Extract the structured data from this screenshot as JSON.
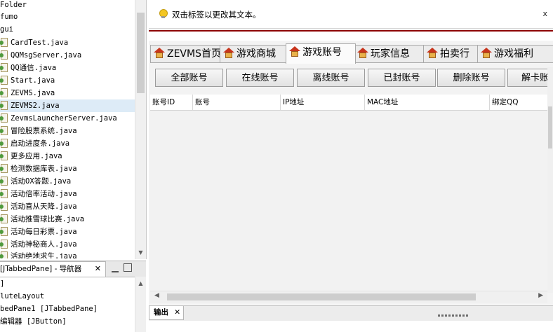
{
  "project_tree": {
    "items": [
      {
        "label": "Folder",
        "icon": "folder-icon"
      },
      {
        "label": "fumo",
        "icon": "folder-icon"
      },
      {
        "label": "gui",
        "icon": "folder-icon"
      },
      {
        "label": "CardTest.java",
        "icon": "java-file-icon"
      },
      {
        "label": "QQMsgServer.java",
        "icon": "java-file-icon"
      },
      {
        "label": "QQ通信.java",
        "icon": "java-file-icon"
      },
      {
        "label": "Start.java",
        "icon": "java-file-icon"
      },
      {
        "label": "ZEVMS.java",
        "icon": "java-file-icon"
      },
      {
        "label": "ZEVMS2.java",
        "icon": "java-file-icon"
      },
      {
        "label": "ZevmsLauncherServer.java",
        "icon": "java-file-icon"
      },
      {
        "label": "冒险股票系统.java",
        "icon": "java-file-icon"
      },
      {
        "label": "启动进度条.java",
        "icon": "java-file-icon"
      },
      {
        "label": "更多应用.java",
        "icon": "java-file-icon"
      },
      {
        "label": "检测数据库表.java",
        "icon": "java-file-icon"
      },
      {
        "label": "活动OX答题.java",
        "icon": "java-file-icon"
      },
      {
        "label": "活动倍率活动.java",
        "icon": "java-file-icon"
      },
      {
        "label": "活动喜从天降.java",
        "icon": "java-file-icon"
      },
      {
        "label": "活动推雪球比赛.java",
        "icon": "java-file-icon"
      },
      {
        "label": "活动每日彩票.java",
        "icon": "java-file-icon"
      },
      {
        "label": "活动神秘商人.java",
        "icon": "java-file-icon"
      },
      {
        "label": "活动绝地求生.java",
        "icon": "java-file-icon"
      }
    ],
    "selected_index": 8
  },
  "navigator": {
    "tab_label": "[JTabbedPane] - 导航器",
    "tab_close": "✕",
    "items": [
      {
        "label": "]"
      },
      {
        "label": "luteLayout"
      },
      {
        "label": "bedPane1 [JTabbedPane]"
      },
      {
        "label": "编辑器 [JButton]"
      }
    ]
  },
  "message_bar": {
    "text": "双击标签以更改其文本。",
    "close": "x",
    "icon": "lightbulb-icon"
  },
  "tabs": [
    {
      "label": "ZEVMS首页",
      "icon": "house-icon"
    },
    {
      "label": "游戏商城",
      "icon": "house-icon"
    },
    {
      "label": "游戏账号",
      "icon": "house-icon",
      "active": true
    },
    {
      "label": "玩家信息",
      "icon": "house-icon"
    },
    {
      "label": "拍卖行",
      "icon": "house-icon"
    },
    {
      "label": "游戏福利",
      "icon": "house-icon"
    }
  ],
  "buttons": [
    "全部账号",
    "在线账号",
    "离线账号",
    "已封账号",
    "删除账号",
    "解卡账号"
  ],
  "table": {
    "columns": [
      "账号ID",
      "账号",
      "IP地址",
      "MAC地址",
      "绑定QQ"
    ]
  },
  "output": {
    "tab_label": "输出",
    "tab_close": "✕"
  },
  "colors": {
    "frame_border": "#8d0000",
    "tab_active_bg": "#fbfbfb",
    "button_border": "#9c9c9c",
    "house_roof": "#c8341c"
  }
}
